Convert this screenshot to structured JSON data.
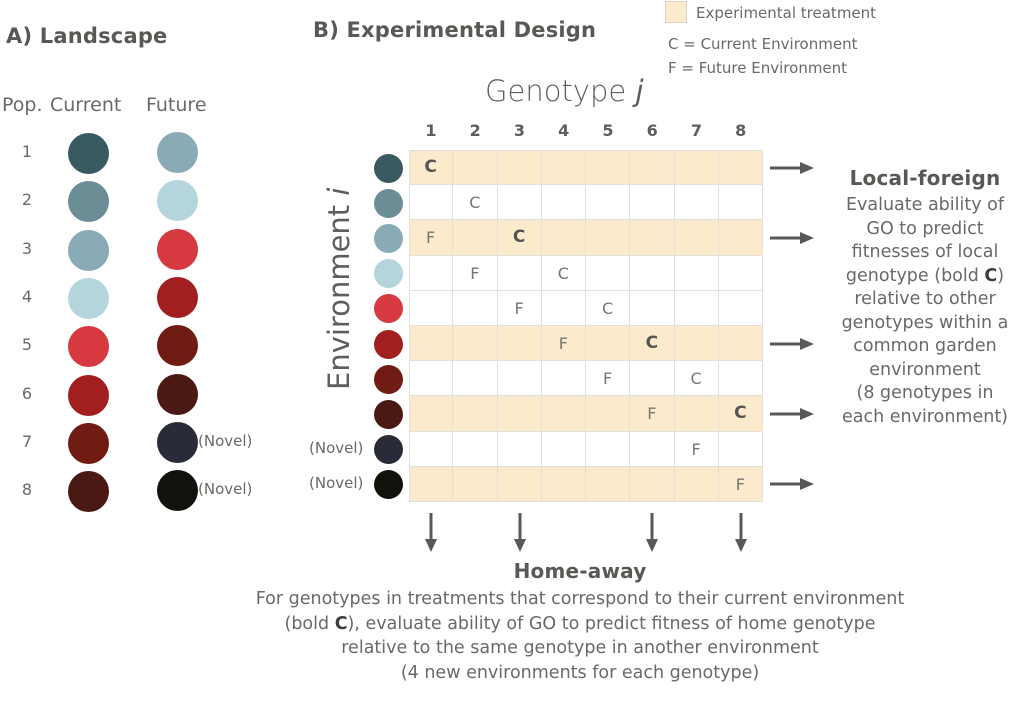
{
  "panel_a": {
    "title": "A) Landscape",
    "headers": {
      "pop": "Pop.",
      "current": "Current",
      "future": "Future"
    },
    "populations": [
      {
        "label": "1",
        "current_color": "#3a5a62",
        "future_color": "#89abb5",
        "future_note": ""
      },
      {
        "label": "2",
        "current_color": "#6a8d96",
        "future_color": "#b4d5dc",
        "future_note": ""
      },
      {
        "label": "3",
        "current_color": "#89abb5",
        "future_color": "#d6393f",
        "future_note": ""
      },
      {
        "label": "4",
        "current_color": "#b4d5dc",
        "future_color": "#a21f20",
        "future_note": ""
      },
      {
        "label": "5",
        "current_color": "#d6393f",
        "future_color": "#711c13",
        "future_note": ""
      },
      {
        "label": "6",
        "current_color": "#a21f20",
        "future_color": "#4b1914",
        "future_note": ""
      },
      {
        "label": "7",
        "current_color": "#711c13",
        "future_color": "#2a2b38",
        "future_note": "(Novel)"
      },
      {
        "label": "8",
        "current_color": "#4b1914",
        "future_color": "#12110c",
        "future_note": "(Novel)"
      }
    ]
  },
  "panel_b": {
    "title": "B) Experimental Design",
    "legend": {
      "treatment_label": "Experimental treatment",
      "treatment_color": "#fbeacb",
      "c_label": "C = Current Environment",
      "f_label": "F = Future Environment"
    },
    "genotype_axis": "Genotype j",
    "environment_axis": "Environment i",
    "genotypes": [
      "1",
      "2",
      "3",
      "4",
      "5",
      "6",
      "7",
      "8"
    ],
    "environments": [
      {
        "color": "#3a5a62",
        "note": "",
        "shaded": true,
        "cells": [
          "C*",
          "",
          "",
          "",
          "",
          "",
          "",
          ""
        ],
        "arrow": true
      },
      {
        "color": "#6a8d96",
        "note": "",
        "shaded": false,
        "cells": [
          "",
          "C",
          "",
          "",
          "",
          "",
          "",
          ""
        ],
        "arrow": false
      },
      {
        "color": "#89abb5",
        "note": "",
        "shaded": true,
        "cells": [
          "F",
          "",
          "C*",
          "",
          "",
          "",
          "",
          ""
        ],
        "arrow": true
      },
      {
        "color": "#b4d5dc",
        "note": "",
        "shaded": false,
        "cells": [
          "",
          "F",
          "",
          "C",
          "",
          "",
          "",
          ""
        ],
        "arrow": false
      },
      {
        "color": "#d6393f",
        "note": "",
        "shaded": false,
        "cells": [
          "",
          "",
          "F",
          "",
          "C",
          "",
          "",
          ""
        ],
        "arrow": false
      },
      {
        "color": "#a21f20",
        "note": "",
        "shaded": true,
        "cells": [
          "",
          "",
          "",
          "F",
          "",
          "C*",
          "",
          ""
        ],
        "arrow": true
      },
      {
        "color": "#711c13",
        "note": "",
        "shaded": false,
        "cells": [
          "",
          "",
          "",
          "",
          "F",
          "",
          "C",
          ""
        ],
        "arrow": false
      },
      {
        "color": "#4b1914",
        "note": "",
        "shaded": true,
        "cells": [
          "",
          "",
          "",
          "",
          "",
          "F",
          "",
          "C*"
        ],
        "arrow": true
      },
      {
        "color": "#2a2b38",
        "note": "(Novel)",
        "shaded": false,
        "cells": [
          "",
          "",
          "",
          "",
          "",
          "",
          "F",
          ""
        ],
        "arrow": false
      },
      {
        "color": "#12110c",
        "note": "(Novel)",
        "shaded": true,
        "cells": [
          "",
          "",
          "",
          "",
          "",
          "",
          "",
          "F"
        ],
        "arrow": true
      }
    ],
    "down_arrow_columns": [
      1,
      3,
      6,
      8
    ],
    "local_foreign": {
      "title": "Local-foreign",
      "lines": [
        "Evaluate ability of",
        "GO to predict",
        "fitnesses of local",
        "genotype (bold |C|)",
        "relative to other",
        "genotypes within a",
        "common garden",
        "environment",
        "(8 genotypes in",
        "each environment)"
      ]
    },
    "home_away": {
      "title": "Home-away",
      "lines": [
        "For genotypes in treatments that correspond to their current environment",
        "(bold |C|), evaluate ability of GO to predict fitness of home genotype",
        "relative to the same genotype in another environment",
        "(4 new environments for each genotype)"
      ]
    }
  }
}
